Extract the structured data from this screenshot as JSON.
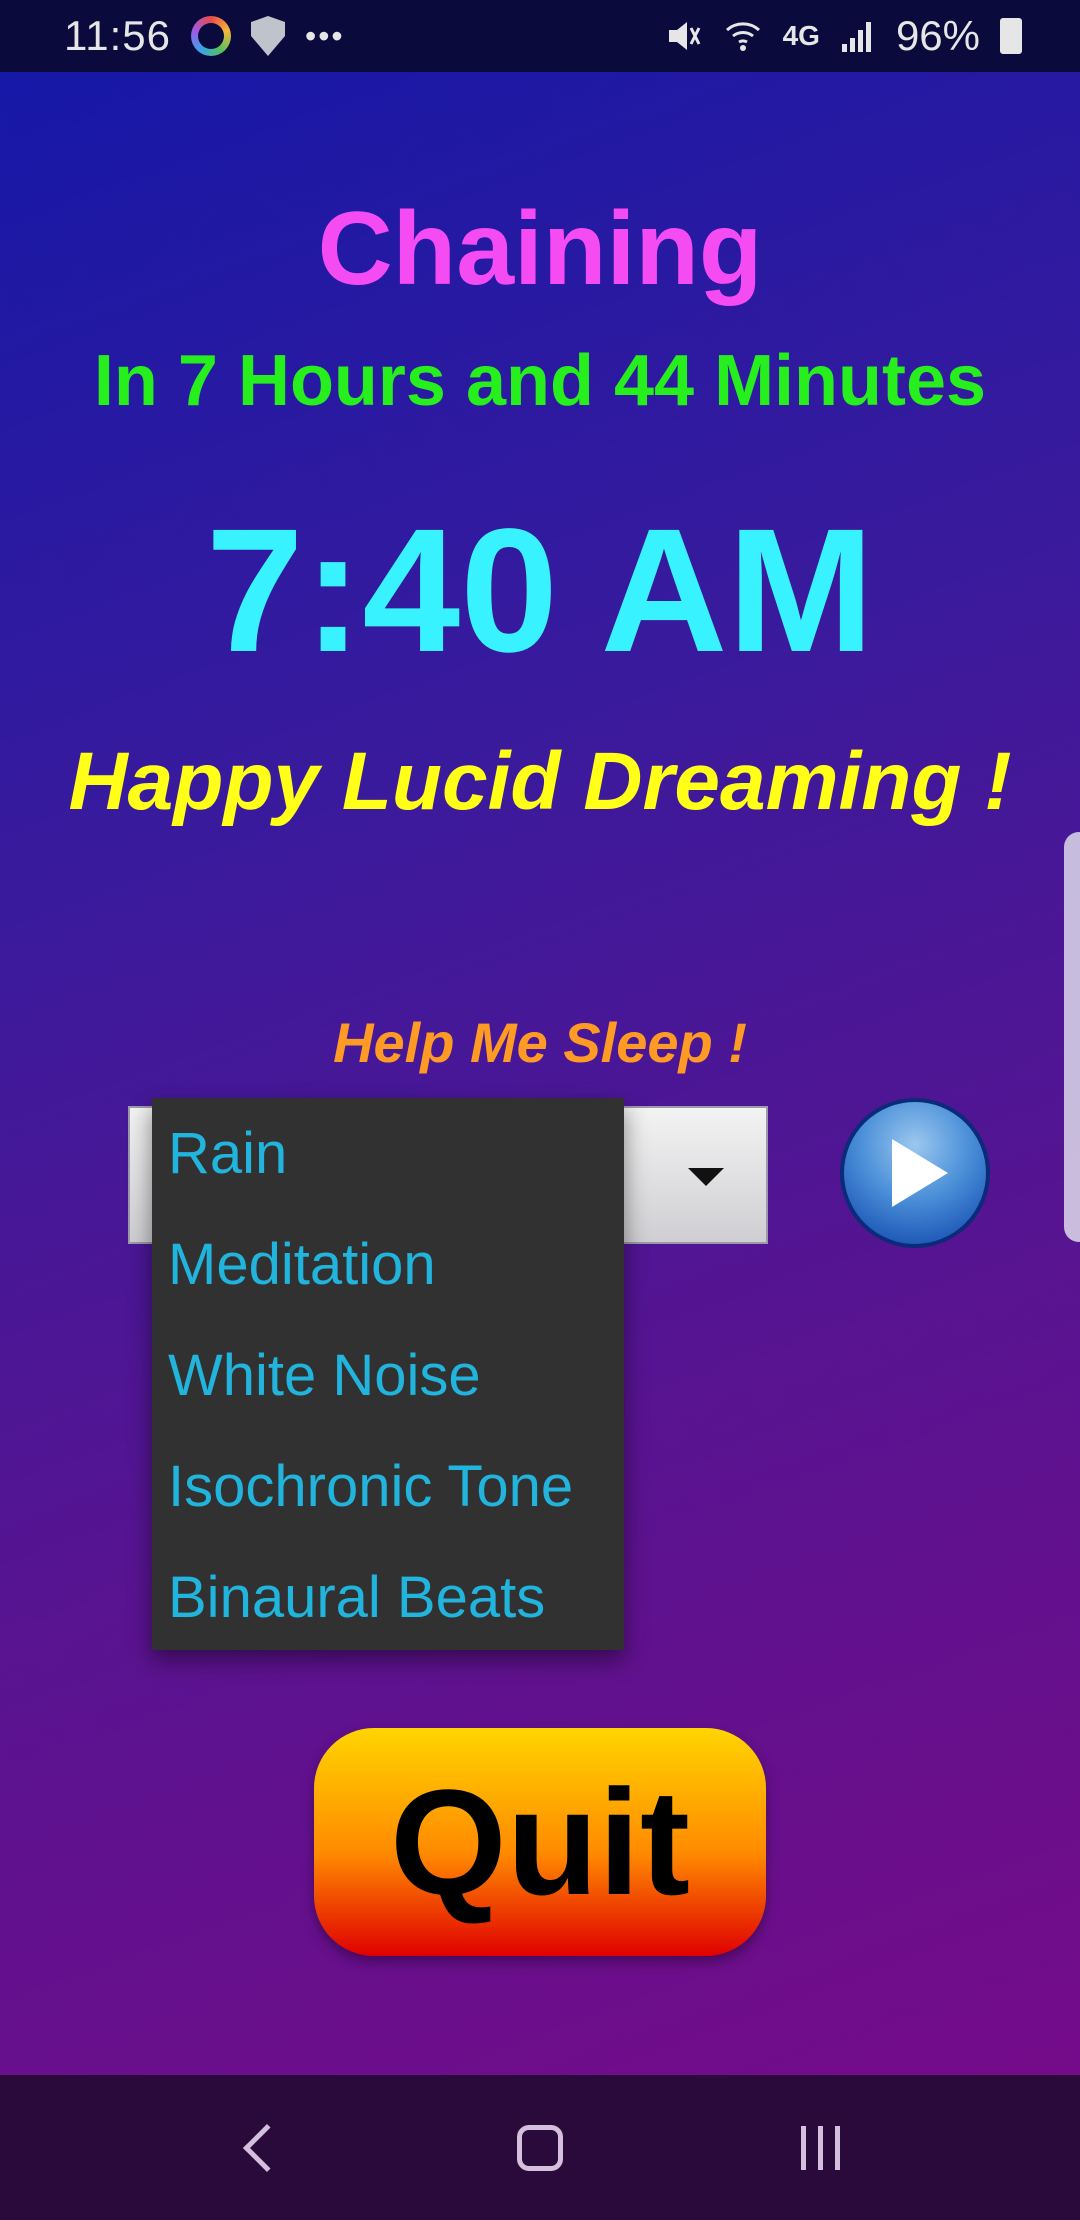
{
  "status_bar": {
    "time": "11:56",
    "network": "4G",
    "battery": "96%",
    "icons": [
      "clock-app-icon",
      "shield-icon",
      "more-dots-icon",
      "mute-icon",
      "wifi-icon",
      "signal-icon",
      "battery-charging-icon"
    ]
  },
  "header": {
    "title": "Chaining",
    "countdown": "In 7 Hours and 44 Minutes",
    "alarm_time": "7:40 AM",
    "message": "Happy Lucid Dreaming !"
  },
  "sleep": {
    "label": "Help Me Sleep !",
    "options": [
      "Rain",
      "Meditation",
      "White Noise",
      "Isochronic Tone",
      "Binaural Beats"
    ]
  },
  "actions": {
    "quit_label": "Quit"
  },
  "colors": {
    "title": "#f54bf3",
    "countdown": "#27ef1d",
    "alarm_time": "#38f3ff",
    "message": "#ffff17",
    "help_label": "#ff9b24",
    "dropdown_text": "#21b4dd"
  }
}
